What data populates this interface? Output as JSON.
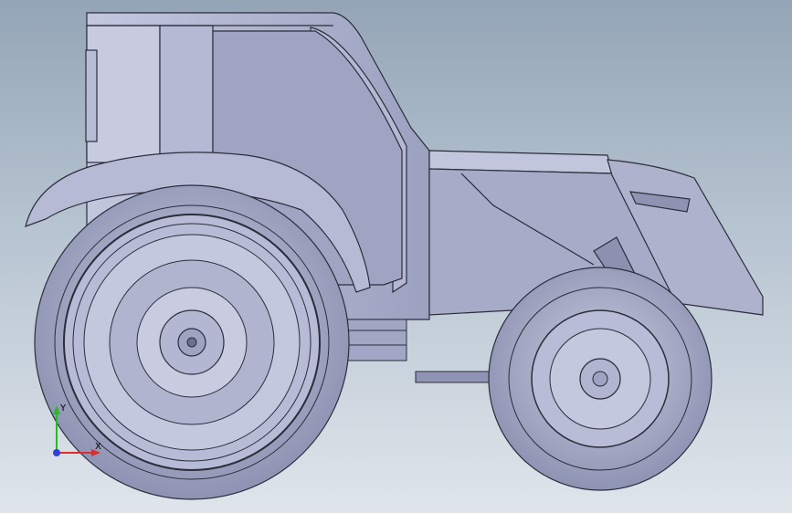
{
  "viewport": {
    "background_top": "#94a5b7",
    "background_bottom": "#dfe5eb"
  },
  "model": {
    "body_color": "#aab0cc",
    "body_shadow": "#8a8fb0",
    "edge_color": "#2b2d3a",
    "tire_color": "#9ea3c2"
  },
  "triad": {
    "x_label": "X",
    "y_label": "Y",
    "x_color": "#d43030",
    "y_color": "#2fb52f",
    "z_color": "#2f3fd8"
  }
}
